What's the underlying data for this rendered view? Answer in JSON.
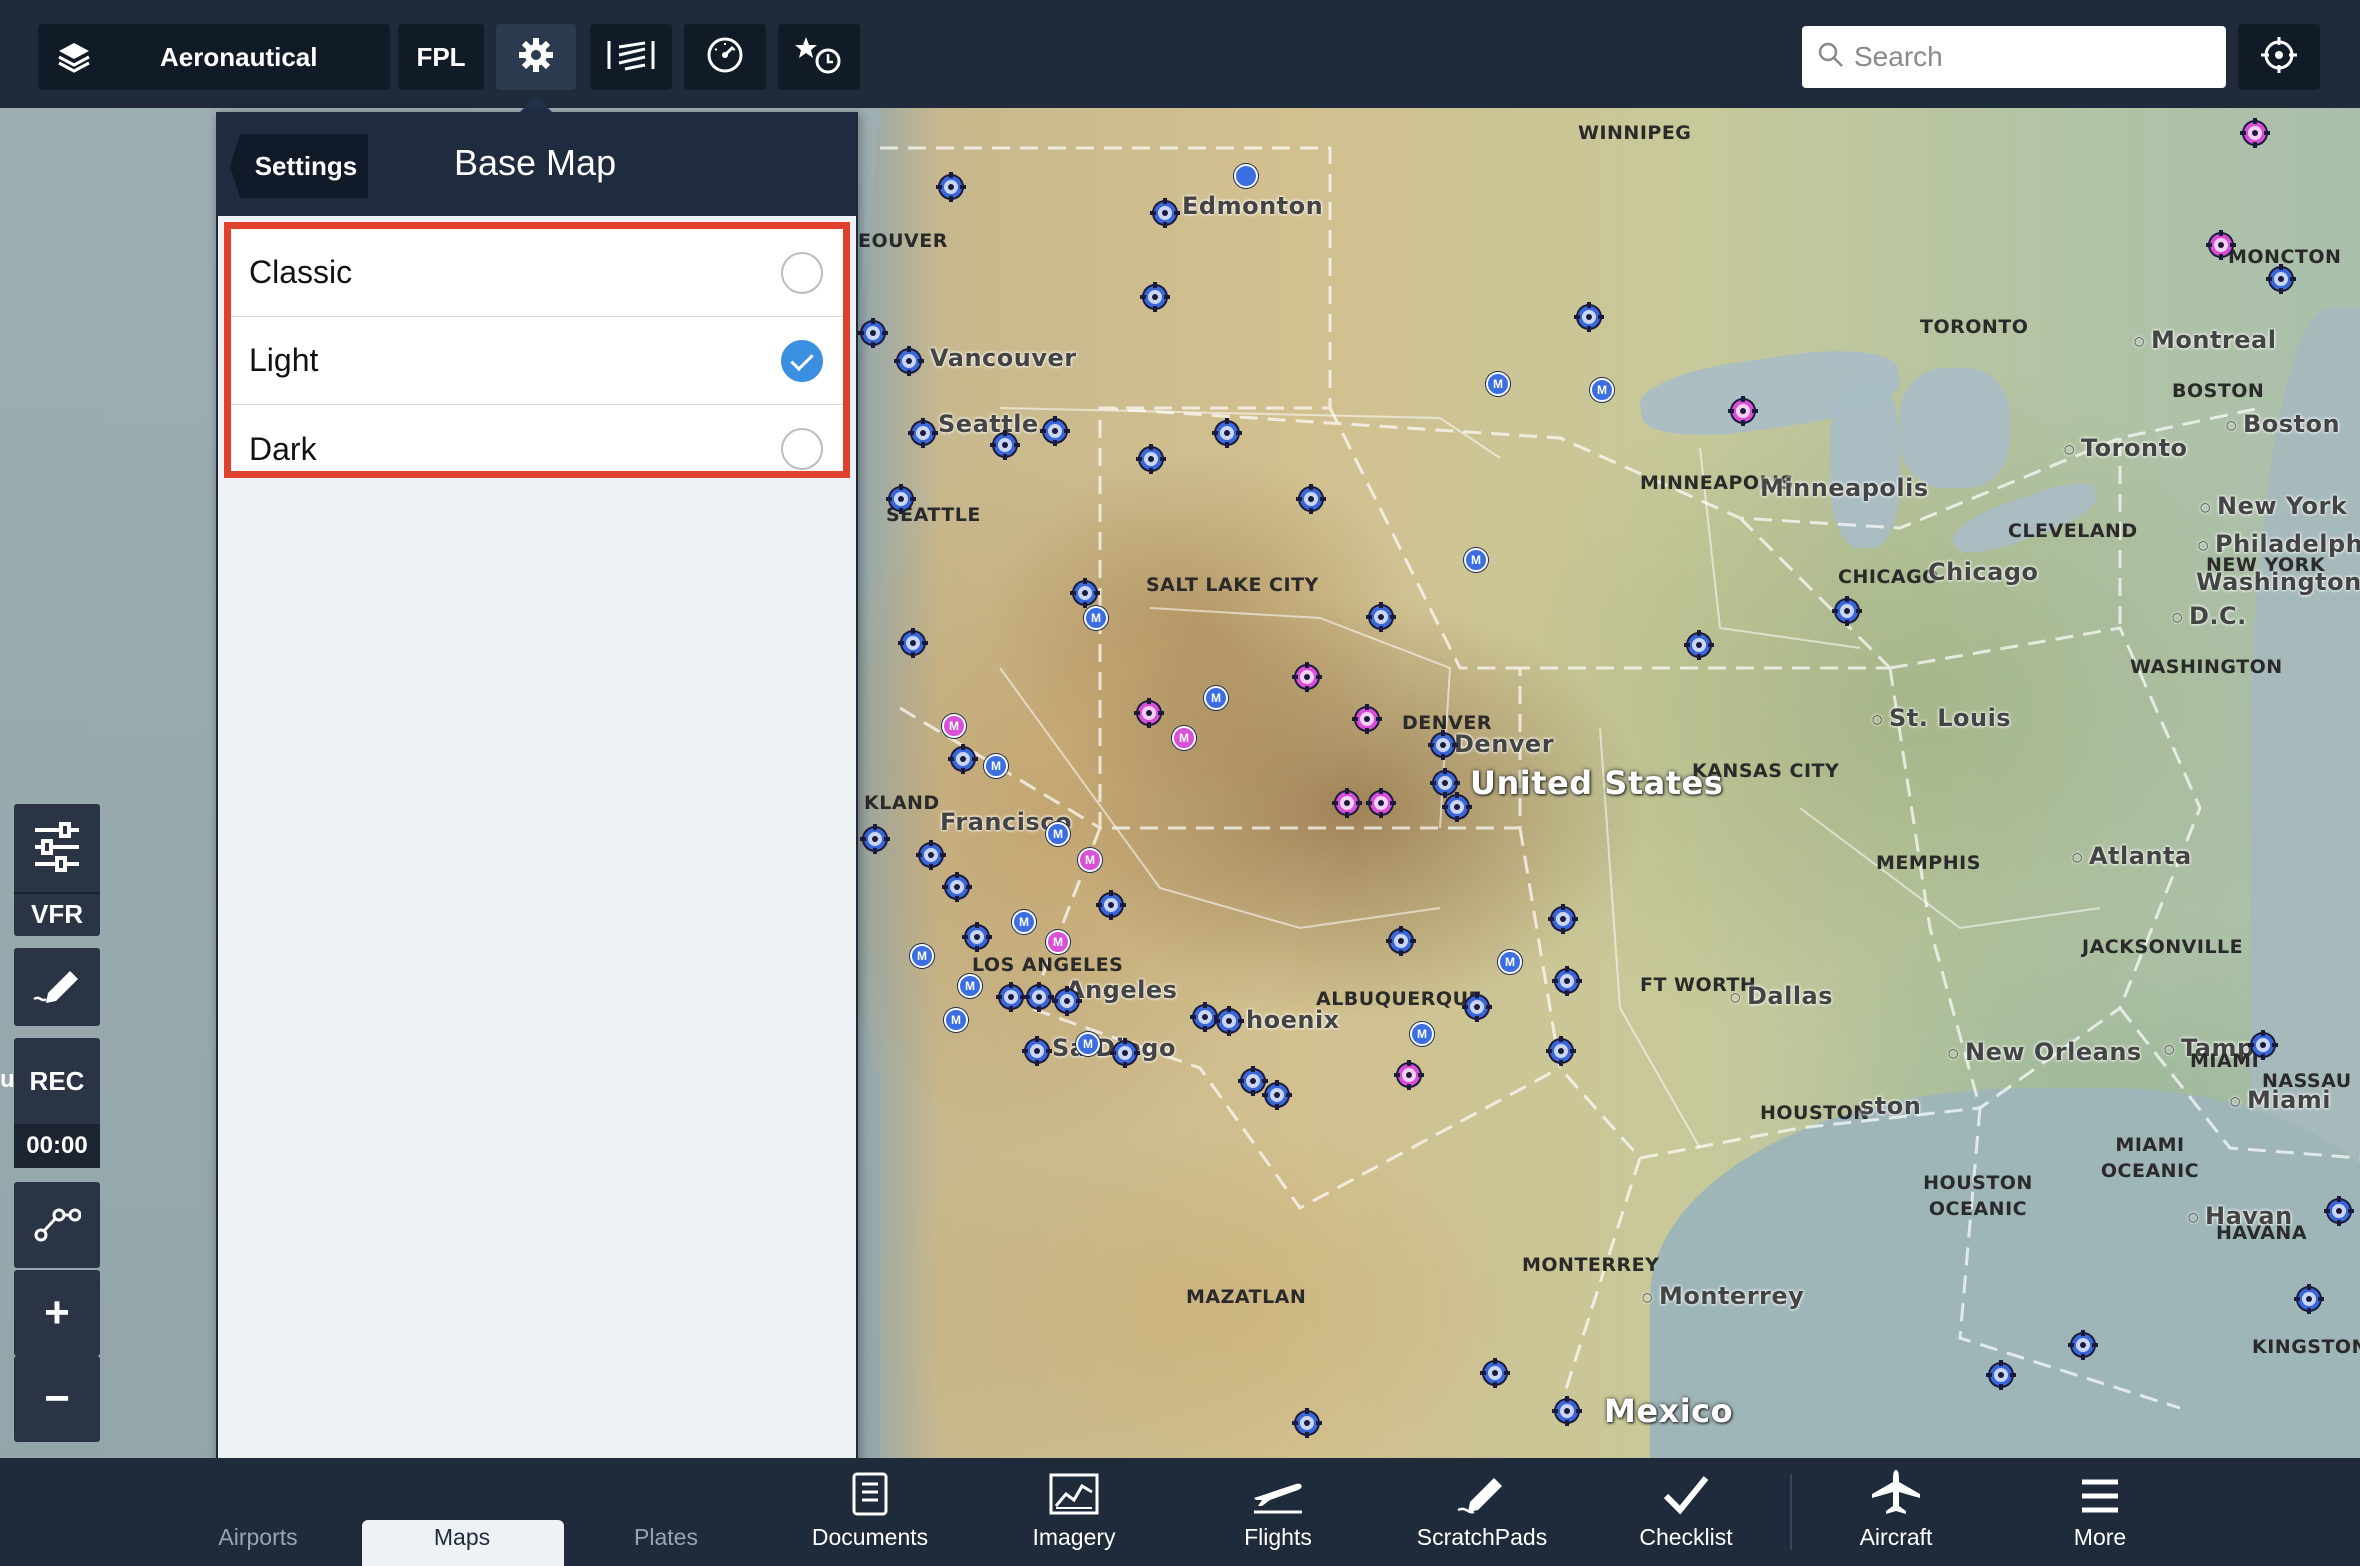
{
  "topbar": {
    "layer_label": "Aeronautical",
    "fpl_label": "FPL",
    "search_placeholder": "Search",
    "icons": [
      "layers-icon",
      "gear-icon",
      "wind-icon",
      "gauge-icon",
      "star-clock-icon",
      "locate-icon"
    ]
  },
  "panel": {
    "back_label": "Settings",
    "title": "Base Map",
    "options": [
      {
        "label": "Classic",
        "selected": false
      },
      {
        "label": "Light",
        "selected": true
      },
      {
        "label": "Dark",
        "selected": false
      }
    ]
  },
  "side": {
    "vfr_label": "VFR",
    "rec_label": "REC",
    "rec_time": "00:00",
    "edge_text": "u"
  },
  "map": {
    "labels": {
      "winnipeg": "WINNIPEG",
      "edmonton": "Edmonton",
      "vancouver_caps": "EOUVER",
      "vancouver": "Vancouver",
      "seattle": "Seattle",
      "seattle_caps": "SEATTLE",
      "moncton": "MONCTON",
      "toronto_caps": "TORONTO",
      "montreal": "Montreal",
      "boston_caps": "BOSTON",
      "boston": "Boston",
      "toronto": "Toronto",
      "minneapolis_caps": "MINNEAPOLIS",
      "minneapolis": "Minneapolis",
      "new_york": "New York",
      "cleveland": "CLEVELAND",
      "philadelphia": "Philadelphia",
      "new_york_caps": "NEW YORK",
      "washington": "Washington",
      "dc": "D.C.",
      "chicago_caps": "CHICAGO",
      "chicago": "Chicago",
      "salt_lake": "SALT LAKE CITY",
      "washington_caps": "WASHINGTON",
      "denver_caps": "DENVER",
      "denver": "Denver",
      "st_louis": "St. Louis",
      "kansas_city": "KANSAS CITY",
      "oakland": "KLAND",
      "san_francisco": "Francisco",
      "united_states": "United States",
      "memphis": "MEMPHIS",
      "atlanta": "Atlanta",
      "jacksonville": "JACKSONVILLE",
      "los_angeles_caps": "LOS ANGELES",
      "los_angeles": "Angeles",
      "albuquerque": "ALBUQUERQUE",
      "ft_worth": "FT WORTH",
      "dallas": "Dallas",
      "phoenix": "hoenix",
      "san_diego": "Sa    Diego",
      "new_orleans": "New Orleans",
      "tampa": "Tamp",
      "miami_caps": "MIAMI",
      "nassau": "NASSAU",
      "miami": "Miami",
      "houston_caps": "HOUSTON",
      "houston": "ston",
      "miami_oceanic": "MIAMI OCEANIC",
      "houston_oceanic": "HOUSTON OCEANIC",
      "havana": "Havan",
      "havana_caps": "HAVANA",
      "monterrey_caps": "MONTERREY",
      "monterrey": "Monterrey",
      "mazatlan": "MAZATLAN",
      "kingston": "KINGSTON",
      "mexico": "Mexico"
    }
  },
  "tabs": [
    {
      "label": "Airports",
      "icon": "airport-icon"
    },
    {
      "label": "Maps",
      "icon": "map-icon"
    },
    {
      "label": "Plates",
      "icon": "plates-icon"
    },
    {
      "label": "Documents",
      "icon": "documents-icon"
    },
    {
      "label": "Imagery",
      "icon": "imagery-icon"
    },
    {
      "label": "Flights",
      "icon": "flights-icon"
    },
    {
      "label": "ScratchPads",
      "icon": "scratchpad-icon"
    },
    {
      "label": "Checklist",
      "icon": "checklist-icon"
    },
    {
      "label": "Aircraft",
      "icon": "aircraft-icon"
    },
    {
      "label": "More",
      "icon": "more-icon"
    }
  ],
  "colors": {
    "accent": "#3a8fe0",
    "highlight_border": "#e0402e",
    "bar": "#1f2a3a",
    "airport_blue": "#3a66d8",
    "airport_pink": "#d64fd6"
  }
}
